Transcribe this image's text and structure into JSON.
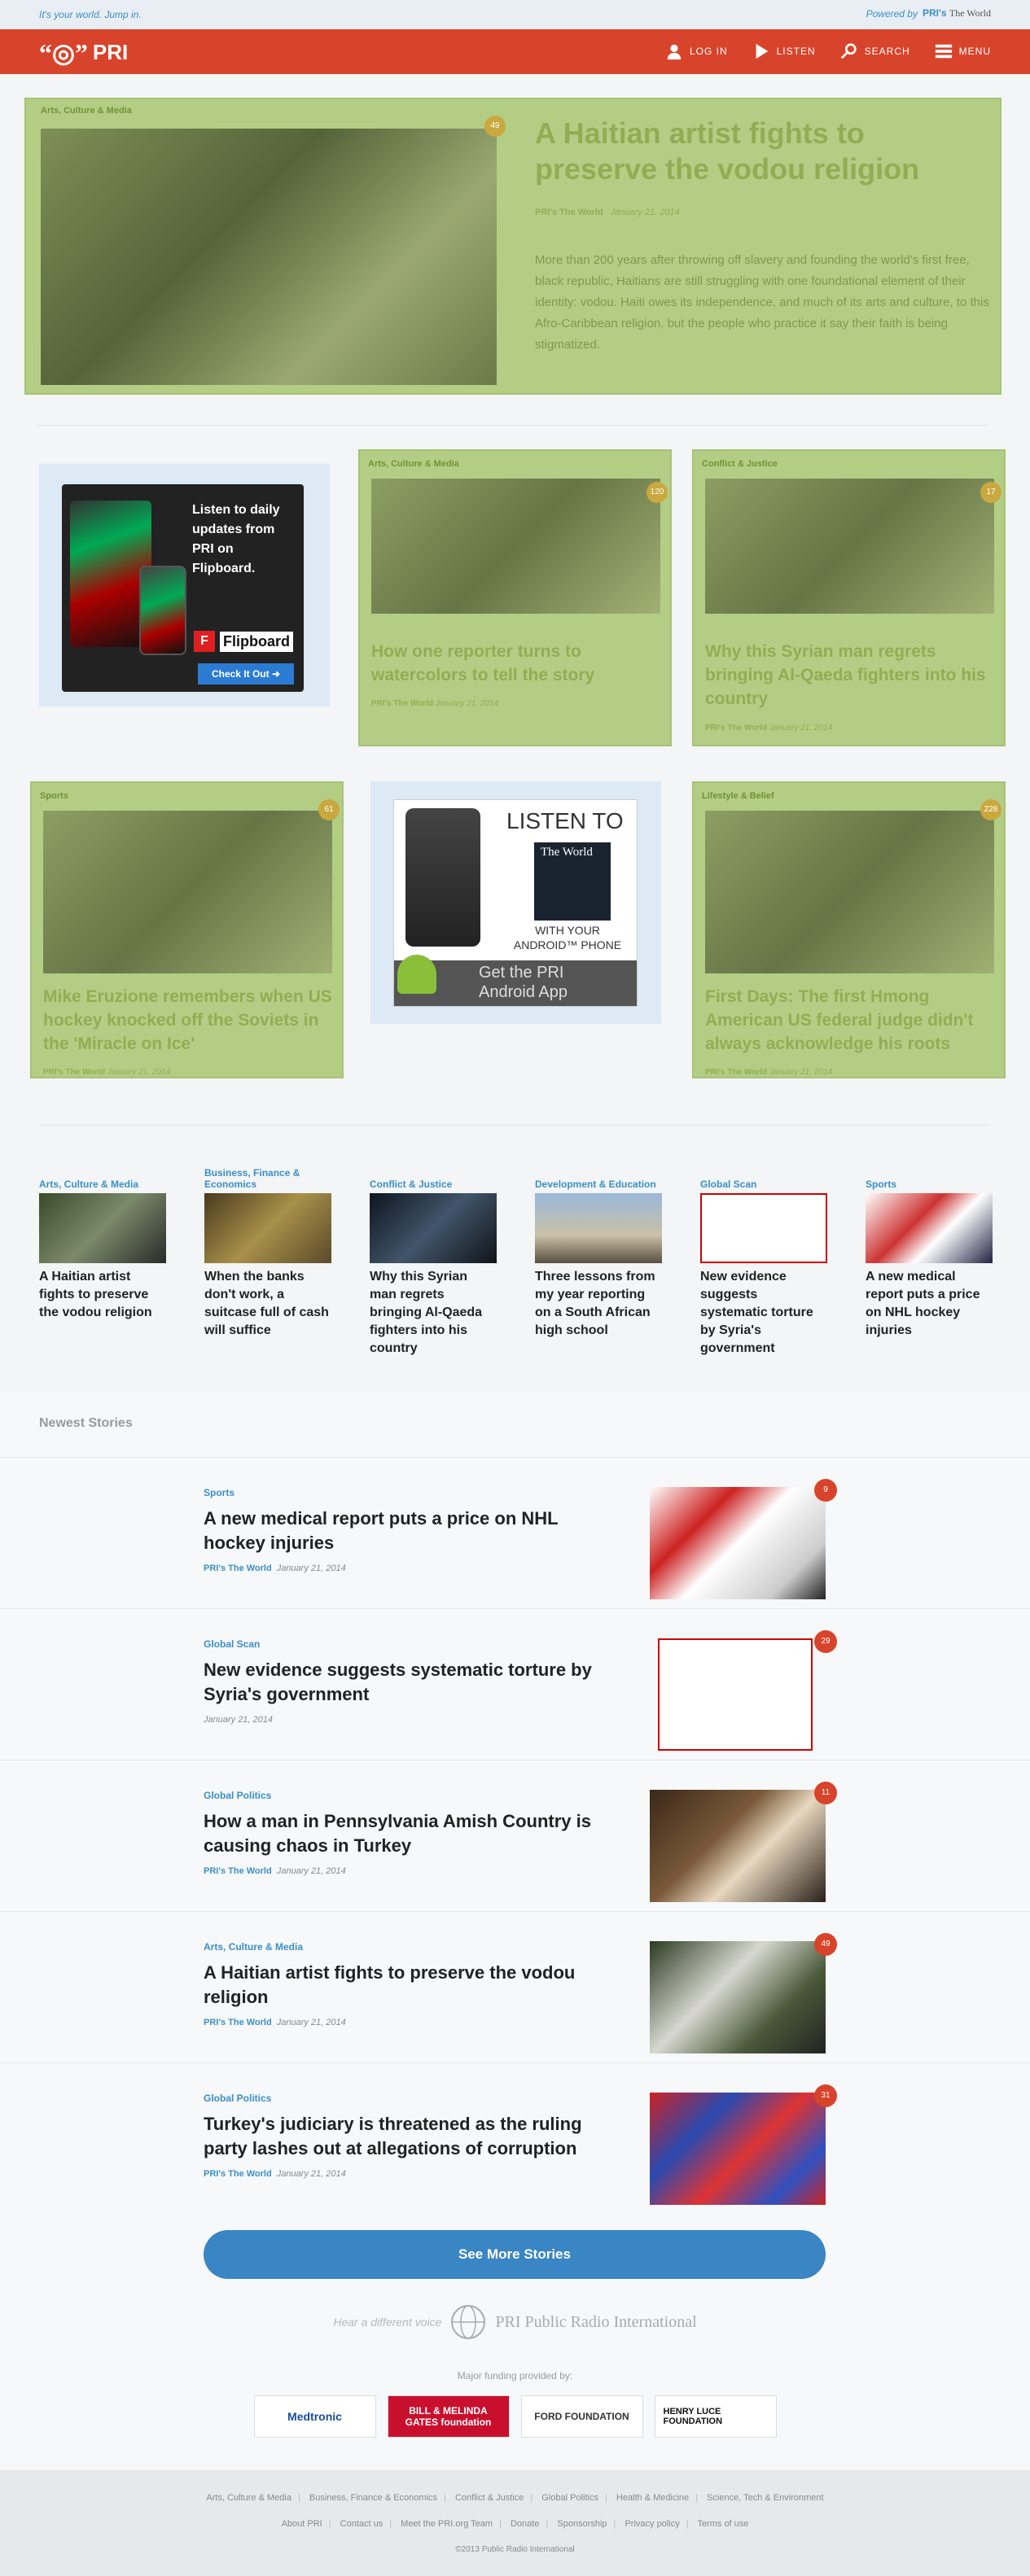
{
  "topbar": {
    "tagline": "It's your world. Jump in.",
    "powered": "Powered by",
    "brand": "PRI's",
    "brand2": "The World"
  },
  "nav": {
    "logo": "PRI",
    "login": "LOG IN",
    "listen": "LISTEN",
    "search": "SEARCH",
    "menu": "MENU"
  },
  "hero": {
    "category": "Arts, Culture & Media",
    "badge": "49",
    "title": "A Haitian artist fights to preserve the vodou religion",
    "meta_brand": "PRI's The World",
    "date": "January 21, 2014",
    "description": "More than 200 years after throwing off slavery and founding the world's first free, black republic, Haitians are still struggling with one foundational element of their identity: vodou. Haiti owes its independence, and much of its arts and culture, to this Afro-Caribbean religion, but the people who practice it say their faith is being stigmatized."
  },
  "ads": {
    "flipboard": {
      "line": "Listen to daily updates from PRI on Flipboard.",
      "brand": "Flipboard",
      "cta": "Check It Out"
    },
    "android": {
      "l1": "LISTEN TO",
      "l2": "The World",
      "l3": "WITH YOUR",
      "l4": "ANDROID™ PHONE",
      "l5": "Get the PRI",
      "l6": "Android App"
    }
  },
  "cards": [
    {
      "category": "Arts, Culture & Media",
      "badge": "120",
      "title": "How one reporter turns to watercolors to tell the story",
      "brand": "PRI's The World",
      "date": "January 21, 2014"
    },
    {
      "category": "Conflict & Justice",
      "badge": "17",
      "title": "Why this Syrian man regrets bringing Al-Qaeda fighters into his country",
      "brand": "PRI's The World",
      "date": "January 21, 2014"
    },
    {
      "category": "Sports",
      "badge": "61",
      "title": "Mike Eruzione remembers when US hockey knocked off the Soviets in the 'Miracle on Ice'",
      "brand": "PRI's The World",
      "date": "January 21, 2014"
    },
    {
      "category": "Lifestyle & Belief",
      "badge": "228",
      "title": "First Days: The first Hmong American US federal judge didn't always acknowledge his roots",
      "brand": "PRI's The World",
      "date": "January 21, 2014"
    }
  ],
  "mini": [
    {
      "category": "Arts, Culture & Media",
      "title": "A Haitian artist fights to preserve the vodou religion"
    },
    {
      "category": "Business, Finance & Economics",
      "title": "When the banks don't work, a suitcase full of cash will suffice"
    },
    {
      "category": "Conflict & Justice",
      "title": "Why this Syrian man regrets bringing Al-Qaeda fighters into his country"
    },
    {
      "category": "Development & Education",
      "title": "Three lessons from my year reporting on a South African high school"
    },
    {
      "category": "Global Scan",
      "title": "New evidence suggests systematic torture by Syria's government"
    },
    {
      "category": "Sports",
      "title": "A new medical report puts a price on NHL hockey injuries"
    }
  ],
  "newest": {
    "heading": "Newest Stories",
    "stories": [
      {
        "category": "Sports",
        "title": "A new medical report puts a price on NHL hockey injuries",
        "brand": "PRI's The World",
        "date": "January 21, 2014",
        "badge": "9"
      },
      {
        "category": "Global Scan",
        "title": "New evidence suggests systematic torture by Syria's government",
        "brand": "",
        "date": "January 21, 2014",
        "badge": "29"
      },
      {
        "category": "Global Politics",
        "title": "How a man in Pennsylvania Amish Country is causing chaos in Turkey",
        "brand": "PRI's The World",
        "date": "January 21, 2014",
        "badge": "11"
      },
      {
        "category": "Arts, Culture & Media",
        "title": "A Haitian artist fights to preserve the vodou religion",
        "brand": "PRI's The World",
        "date": "January 21, 2014",
        "badge": "49"
      },
      {
        "category": "Global Politics",
        "title": "Turkey's judiciary is threatened as the ruling party lashes out at allegations of corruption",
        "brand": "PRI's The World",
        "date": "January 21, 2014",
        "badge": "31"
      }
    ],
    "see_more": "See More Stories"
  },
  "footer_brand": {
    "tagline": "Hear a different voice",
    "name": "PRI Public Radio International"
  },
  "funding": {
    "label": "Major funding provided by:",
    "funders": [
      "Medtronic",
      "BILL & MELINDA GATES foundation",
      "FORD FOUNDATION",
      "HENRY LUCE FOUNDATION"
    ]
  },
  "footer": {
    "row1": [
      "Arts, Culture & Media",
      "Business, Finance & Economics",
      "Conflict & Justice",
      "Global Politics",
      "Health & Medicine",
      "Science, Tech & Environment"
    ],
    "row2": [
      "About PRI",
      "Contact us",
      "Meet the PRI.org Team",
      "Donate",
      "Sponsorship",
      "Privacy policy",
      "Terms of use"
    ],
    "copyright": "©2013 Public Radio International"
  }
}
